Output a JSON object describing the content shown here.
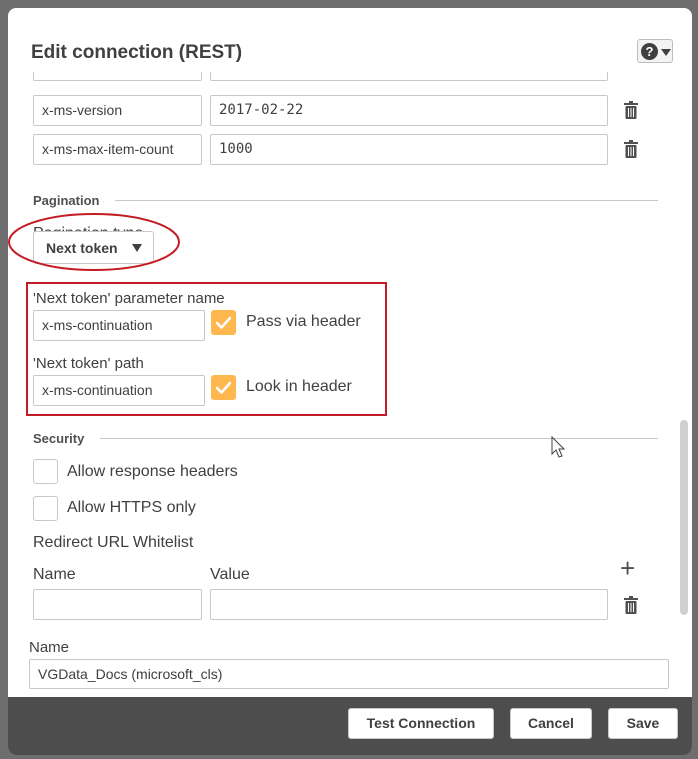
{
  "dialog": {
    "title": "Edit connection (REST)",
    "help_glyph": "?"
  },
  "headers": [
    {
      "name": "x-ms-version",
      "value": "2017-02-22"
    },
    {
      "name": "x-ms-max-item-count",
      "value": "1000"
    }
  ],
  "pagination": {
    "section_label": "Pagination",
    "type_label": "Pagination type",
    "type_value": "Next token",
    "param_label": "'Next token' parameter name",
    "param_value": "x-ms-continuation",
    "pass_via_header_label": "Pass via header",
    "pass_via_header_checked": true,
    "path_label": "'Next token' path",
    "path_value": "x-ms-continuation",
    "look_in_header_label": "Look in header",
    "look_in_header_checked": true
  },
  "security": {
    "section_label": "Security",
    "allow_response_headers_label": "Allow response headers",
    "allow_response_headers_checked": false,
    "allow_https_only_label": "Allow HTTPS only",
    "allow_https_only_checked": false,
    "redirect_label": "Redirect URL Whitelist",
    "name_col": "Name",
    "value_col": "Value",
    "add_glyph": "+"
  },
  "connection_name": {
    "label": "Name",
    "value": "VGData_Docs (microsoft_cls)"
  },
  "footer": {
    "test_label": "Test Connection",
    "cancel_label": "Cancel",
    "save_label": "Save"
  },
  "colors": {
    "accent_checkbox": "#ffb84d",
    "annotation_red": "#c41c24",
    "footer_bg": "#4d4d4d"
  }
}
